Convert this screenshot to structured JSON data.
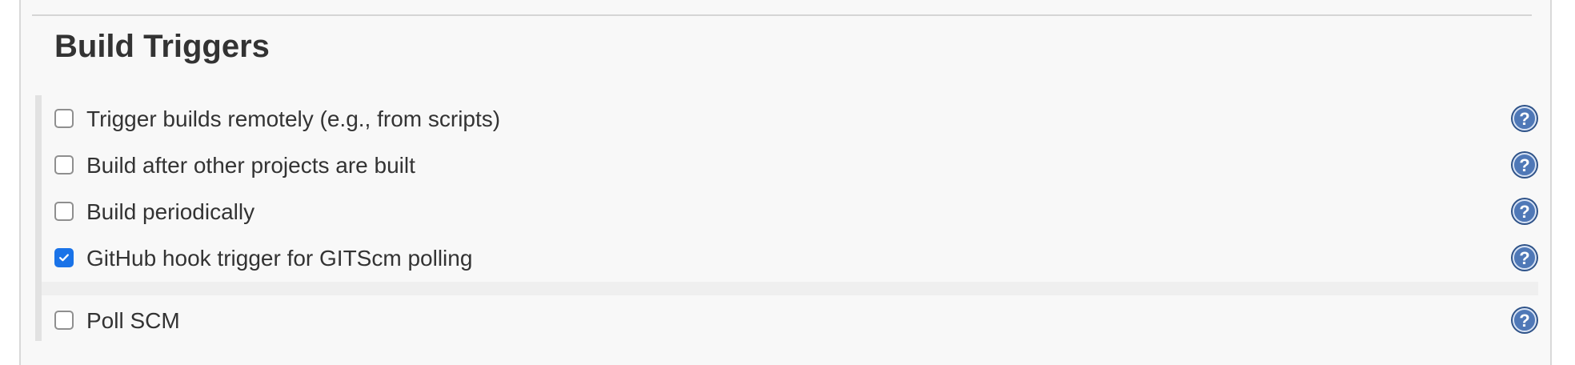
{
  "section": {
    "title": "Build Triggers"
  },
  "triggers": [
    {
      "label": "Trigger builds remotely (e.g., from scripts)",
      "checked": false,
      "help_icon": "help-icon"
    },
    {
      "label": "Build after other projects are built",
      "checked": false,
      "help_icon": "help-icon"
    },
    {
      "label": "Build periodically",
      "checked": false,
      "help_icon": "help-icon"
    },
    {
      "label": "GitHub hook trigger for GITScm polling",
      "checked": true,
      "help_icon": "help-icon"
    },
    {
      "label": "Poll SCM",
      "checked": false,
      "help_icon": "help-icon"
    }
  ],
  "colors": {
    "checkbox_checked": "#1a73e8",
    "help_icon": "#3b5f96",
    "text": "#333333"
  }
}
